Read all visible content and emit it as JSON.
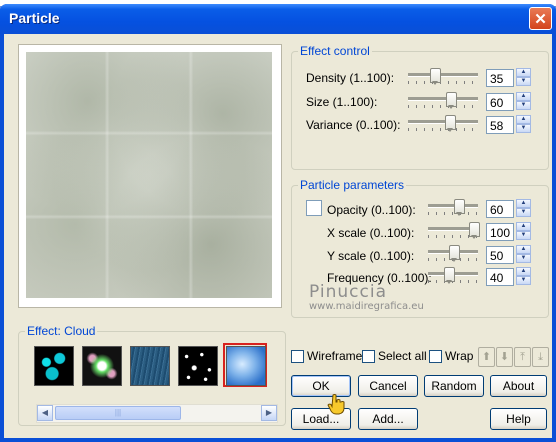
{
  "window": {
    "title": "Particle"
  },
  "effect_control": {
    "legend": "Effect control",
    "rows": [
      {
        "label": "Density (1..100):",
        "value": "35",
        "level": 35
      },
      {
        "label": "Size (1..100):",
        "value": "60",
        "level": 60
      },
      {
        "label": "Variance (0..100):",
        "value": "58",
        "level": 58
      }
    ]
  },
  "particle_parameters": {
    "legend": "Particle parameters",
    "rows": [
      {
        "label": "Opacity (0..100):",
        "value": "60",
        "level": 60
      },
      {
        "label": "X scale (0..100):",
        "value": "100",
        "level": 100
      },
      {
        "label": "Y scale (0..100):",
        "value": "50",
        "level": 50
      },
      {
        "label": "Frequency (0..100):",
        "value": "40",
        "level": 40
      }
    ]
  },
  "effect": {
    "legend": "Effect: Cloud",
    "presets": [
      "bubbles",
      "glow",
      "rain",
      "stars",
      "cloud"
    ],
    "selected": "cloud"
  },
  "options": {
    "wireframe": "Wireframe",
    "select_all": "Select all",
    "wrap": "Wrap"
  },
  "buttons": {
    "ok": "OK",
    "cancel": "Cancel",
    "random": "Random",
    "about": "About",
    "load": "Load...",
    "add": "Add...",
    "help": "Help"
  },
  "watermark": {
    "name": "Pinuccia",
    "url": "www.maidiregrafica.eu"
  },
  "colors": {
    "title_bar": "#0a4fd6",
    "legend_text": "#0046d5",
    "selection_border": "#d8221e"
  }
}
